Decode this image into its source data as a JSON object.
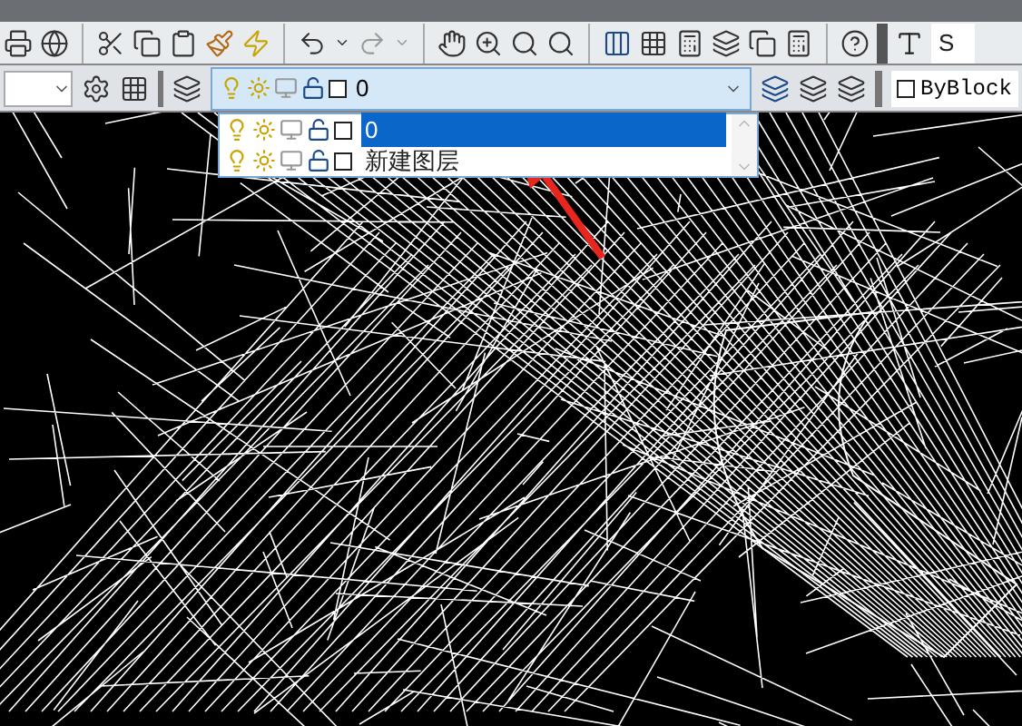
{
  "text_style_field": {
    "value": "S"
  },
  "layer_combo": {
    "value": "0"
  },
  "layer_dropdown": {
    "items": [
      {
        "name": "0",
        "selected": true
      },
      {
        "name": "新建图层",
        "selected": false
      }
    ]
  },
  "color_combo": {
    "value": "ByBlock"
  }
}
